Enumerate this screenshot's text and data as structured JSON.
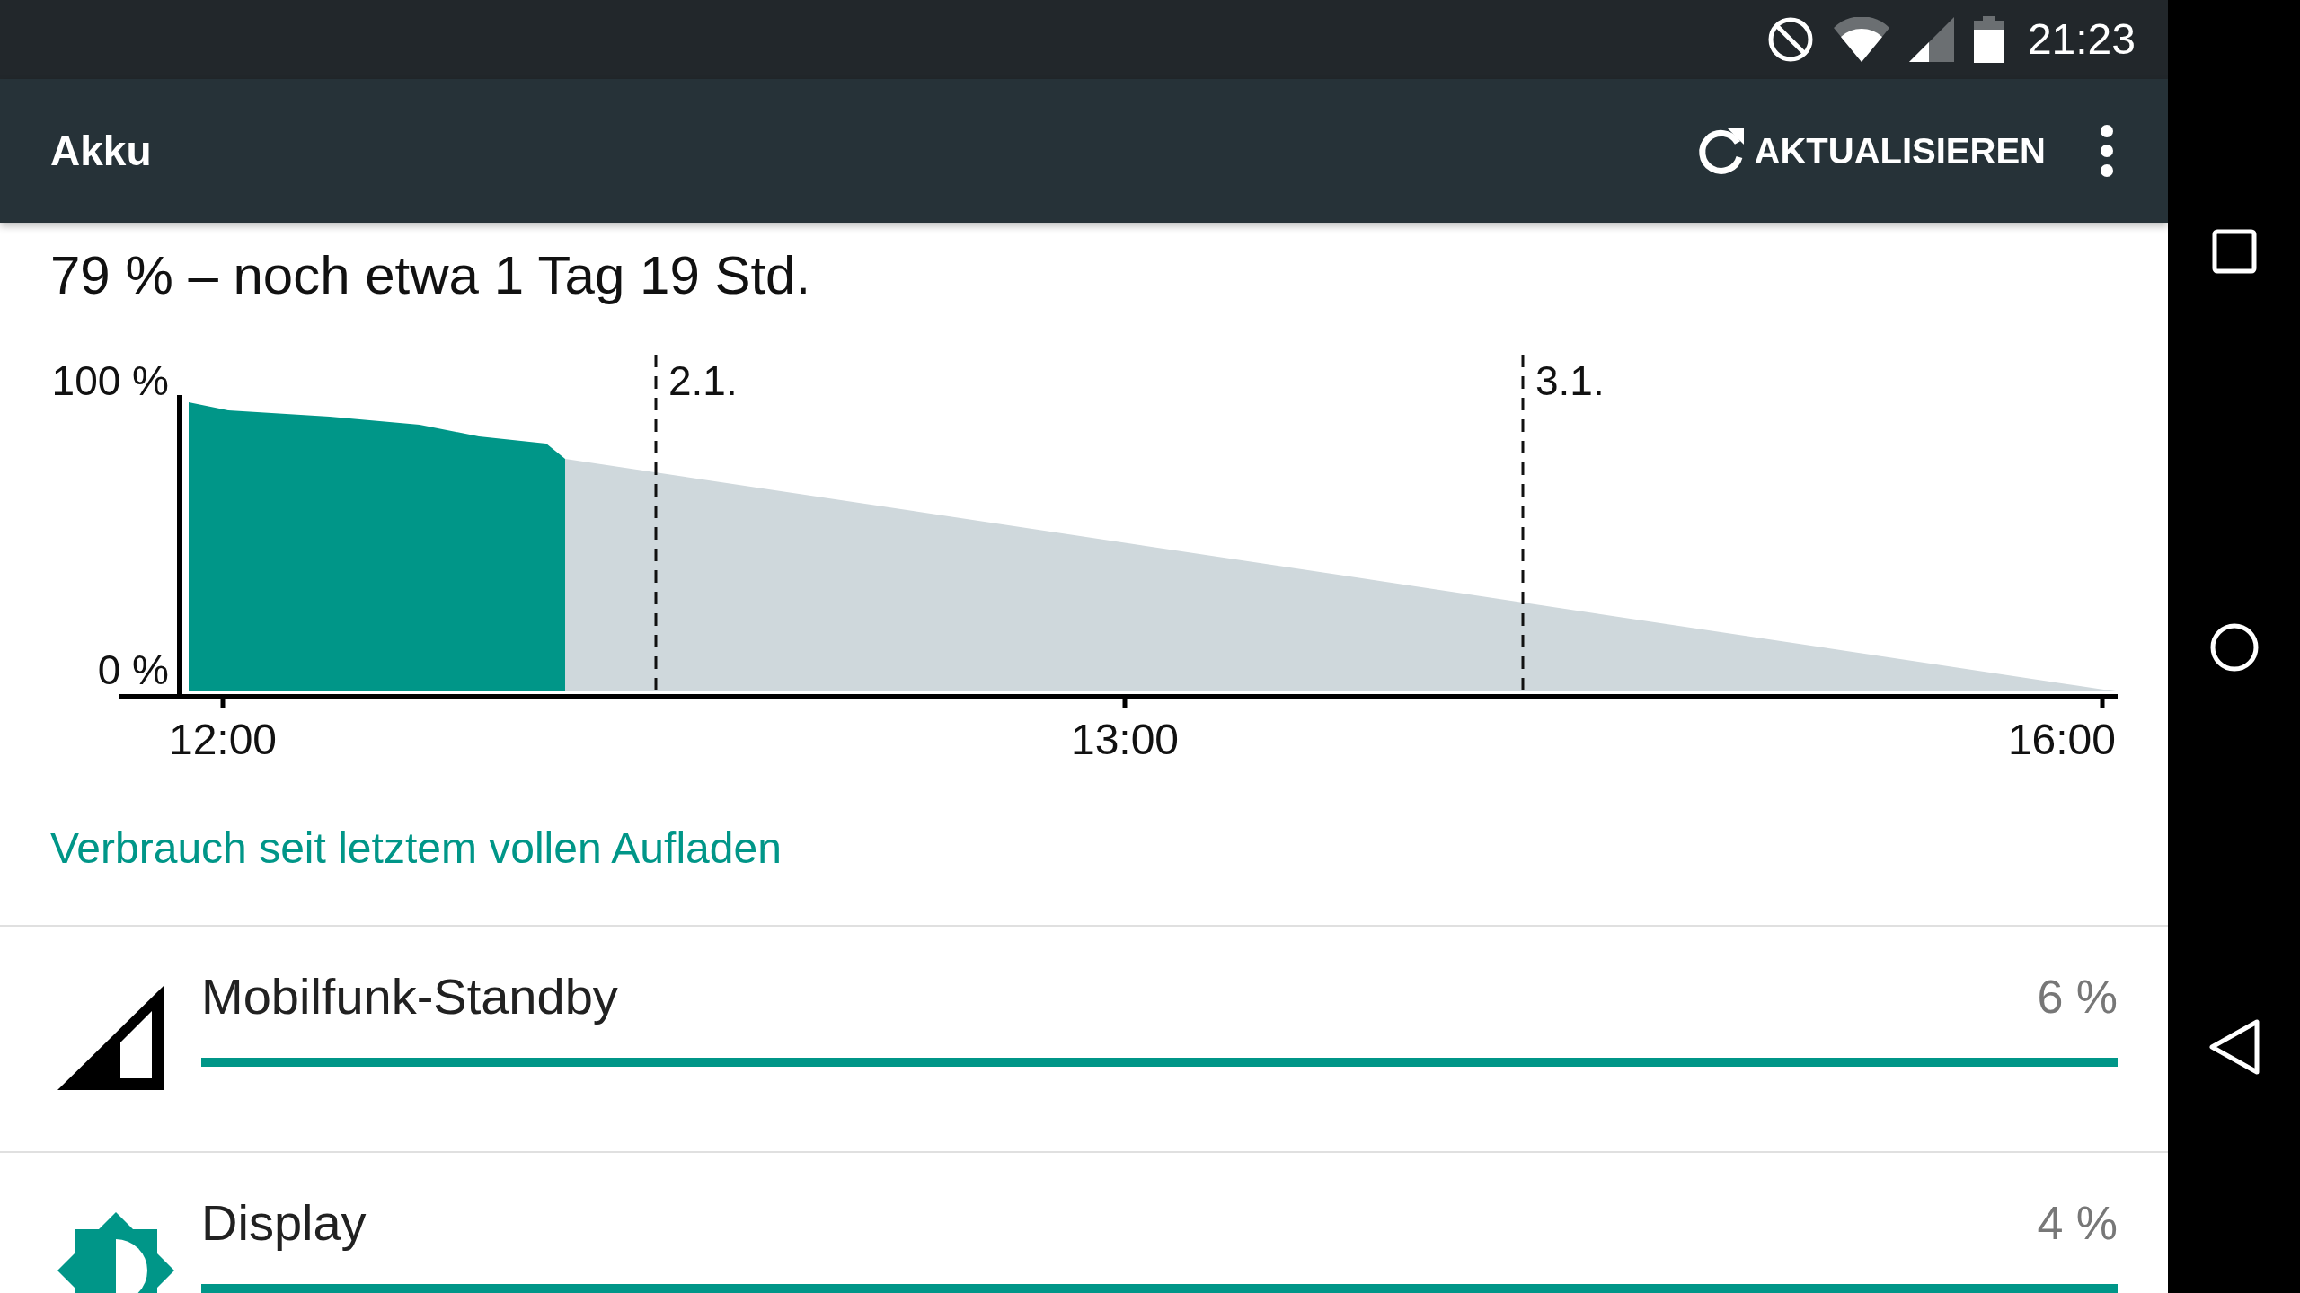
{
  "status_bar": {
    "time": "21:23"
  },
  "app_bar": {
    "title": "Akku",
    "action": "AKTUALISIEREN"
  },
  "summary": "79 % – noch etwa 1 Tag 19 Std.",
  "battery_chart": {
    "y_labels": [
      "100 %",
      "0 %"
    ],
    "x_labels": [
      "12:00",
      "13:00",
      "16:00"
    ],
    "date_markers": [
      "2.1.",
      "3.1."
    ]
  },
  "link": "Verbrauch seit letztem vollen Aufladen",
  "usage": [
    {
      "kind": "signal",
      "label": "Mobilfunk-Standby",
      "percent": "6 %"
    },
    {
      "kind": "display",
      "label": "Display",
      "percent": "4 %"
    }
  ]
}
